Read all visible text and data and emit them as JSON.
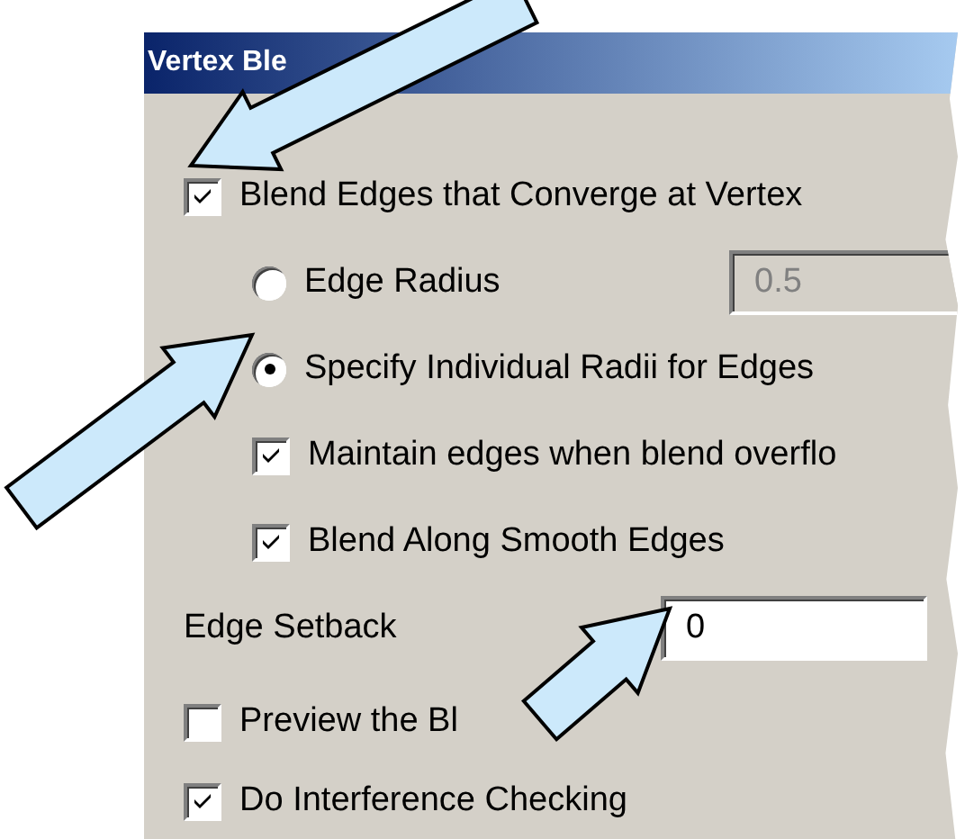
{
  "window": {
    "title": "Vertex Ble"
  },
  "options": [
    {
      "kind": "checkbox",
      "label": "Blend Edges that Converge at Vertex",
      "checked": true,
      "children": [
        {
          "kind": "radio",
          "label": "Edge Radius",
          "selected": false,
          "field": {
            "value": "0.5",
            "disabled": true
          }
        },
        {
          "kind": "radio",
          "label": "Specify Individual Radii for Edges",
          "selected": true
        },
        {
          "kind": "checkbox",
          "label": "Maintain edges when blend overflo",
          "checked": true
        },
        {
          "kind": "checkbox",
          "label": "Blend Along Smooth Edges",
          "checked": true
        }
      ]
    },
    {
      "kind": "field",
      "label": "Edge Setback",
      "field": {
        "value": "0",
        "disabled": false
      }
    }
  ],
  "bottom_options": [
    {
      "kind": "checkbox",
      "label": "Preview the Bl",
      "checked": false
    },
    {
      "kind": "checkbox",
      "label": "Do Interference Checking",
      "checked": true
    }
  ]
}
